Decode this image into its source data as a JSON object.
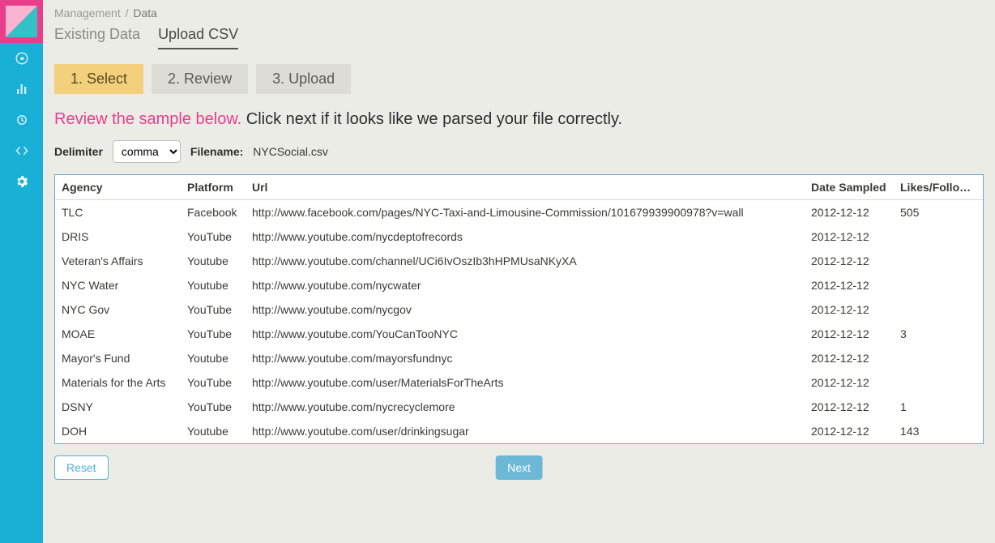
{
  "breadcrumb": {
    "root": "Management",
    "current": "Data"
  },
  "tabs": {
    "existing": "Existing Data",
    "upload": "Upload CSV"
  },
  "steps": {
    "s1": "1. Select",
    "s2": "2. Review",
    "s3": "3. Upload"
  },
  "review": {
    "highlight": "Review the sample below.",
    "rest": "Click next if it looks like we parsed your file correctly."
  },
  "settings": {
    "delimiter_label": "Delimiter",
    "delimiter_value": "comma",
    "filename_label": "Filename:",
    "filename_value": "NYCSocial.csv"
  },
  "columns": {
    "agency": "Agency",
    "platform": "Platform",
    "url": "Url",
    "date": "Date Sampled",
    "likes": "Likes/Follow..."
  },
  "rows": [
    {
      "agency": "TLC",
      "platform": "Facebook",
      "url": "http://www.facebook.com/pages/NYC-Taxi-and-Limousine-Commission/101679939900978?v=wall",
      "date": "2012-12-12",
      "likes": "505"
    },
    {
      "agency": "DRIS",
      "platform": "YouTube",
      "url": "http://www.youtube.com/nycdeptofrecords",
      "date": "2012-12-12",
      "likes": ""
    },
    {
      "agency": "Veteran's Affairs",
      "platform": "Youtube",
      "url": "http://www.youtube.com/channel/UCi6IvOszIb3hHPMUsaNKyXA",
      "date": "2012-12-12",
      "likes": ""
    },
    {
      "agency": "NYC Water",
      "platform": "Youtube",
      "url": "http://www.youtube.com/nycwater",
      "date": "2012-12-12",
      "likes": ""
    },
    {
      "agency": "NYC Gov",
      "platform": "YouTube",
      "url": "http://www.youtube.com/nycgov",
      "date": "2012-12-12",
      "likes": ""
    },
    {
      "agency": "MOAE",
      "platform": "YouTube",
      "url": "http://www.youtube.com/YouCanTooNYC",
      "date": "2012-12-12",
      "likes": "3"
    },
    {
      "agency": "Mayor's Fund",
      "platform": "Youtube",
      "url": "http://www.youtube.com/mayorsfundnyc",
      "date": "2012-12-12",
      "likes": ""
    },
    {
      "agency": "Materials for the Arts",
      "platform": "YouTube",
      "url": "http://www.youtube.com/user/MaterialsForTheArts",
      "date": "2012-12-12",
      "likes": ""
    },
    {
      "agency": "DSNY",
      "platform": "YouTube",
      "url": "http://www.youtube.com/nycrecyclemore",
      "date": "2012-12-12",
      "likes": "1"
    },
    {
      "agency": "DOH",
      "platform": "Youtube",
      "url": "http://www.youtube.com/user/drinkingsugar",
      "date": "2012-12-12",
      "likes": "143"
    }
  ],
  "actions": {
    "reset": "Reset",
    "next": "Next"
  }
}
